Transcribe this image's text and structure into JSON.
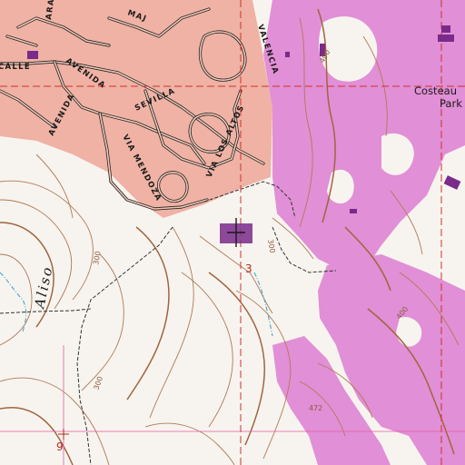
{
  "map": {
    "colors": {
      "background": "#f7f4ef",
      "urban_tint": "#efb2a4",
      "urban_update_tint": "#e18fd6",
      "contour": "#b07a55",
      "street": "#222222",
      "grid_line": "#d0302a",
      "water": "#4aa7c8"
    },
    "labels": {
      "calle": "CALLE",
      "avenida": "AVENIDA",
      "avenida2": "AVENIDA",
      "arana": "ARA",
      "maja": "MAJ",
      "sevilla": "SEVILLA",
      "via_mendoza": "VIA MENDOZA",
      "via_los_altos": "VIA LOS ALTOS",
      "valencia": "VALENCIA",
      "costeau": "Costeau",
      "park": "Park",
      "aliso": "Aliso"
    },
    "elevations": {
      "e400": "400",
      "e300a": "300",
      "e300b": "300",
      "e300c": "300",
      "e472": "472",
      "e400b": "400"
    },
    "section_numbers": {
      "s3": "3",
      "s9": "9"
    },
    "icons": {
      "landmark": "church-symbol-icon"
    }
  }
}
